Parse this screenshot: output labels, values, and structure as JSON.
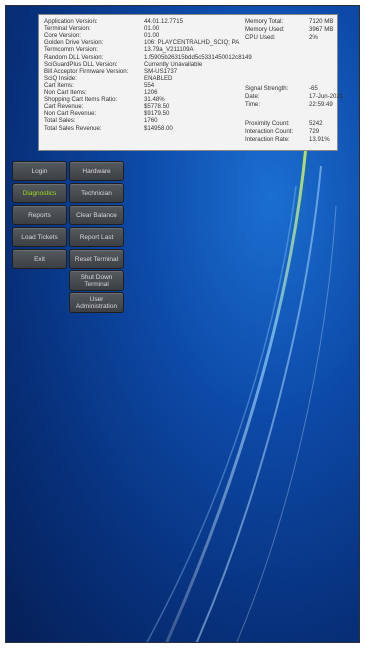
{
  "info_left": [
    {
      "label": "Application Version:",
      "value": "44.01.12.7715"
    },
    {
      "label": "Terminal Version:",
      "value": "01.00"
    },
    {
      "label": "Core Version:",
      "value": "01.00"
    },
    {
      "label": "Golden Drive Version:",
      "value": "106: PLAYCENTRALHD_SCIQ; PA"
    },
    {
      "label": "Termcomm Version:",
      "value": "13.79a_V211109A"
    },
    {
      "label": "Random DLL Version:",
      "value": "1.f5905b26315bdd5c5331450012c8149"
    },
    {
      "label": "SciGuardPlus DLL Version:",
      "value": "Currently Unavailable"
    },
    {
      "label": "Bill Acceptor Firmware Version:",
      "value": "SM-US1737"
    },
    {
      "label": "SciQ Inside:",
      "value": "ENABLED"
    },
    {
      "label": "Cart Items:",
      "value": "554"
    },
    {
      "label": "Non Cart Items:",
      "value": "1206"
    },
    {
      "label": "Shopping Cart Items Ratio:",
      "value": "31.48%"
    },
    {
      "label": "Cart Revenue:",
      "value": "$5778.50"
    },
    {
      "label": "Non Cart Revenue:",
      "value": "$9179.50"
    },
    {
      "label": "Total Sales:",
      "value": "1760"
    },
    {
      "label": "Total Sales Revenue:",
      "value": "$14958.00"
    }
  ],
  "info_right_top": [
    {
      "label": "Memory Total:",
      "value": "7120 MB"
    },
    {
      "label": "Memory Used:",
      "value": "3967 MB"
    },
    {
      "label": "CPU Used:",
      "value": "2%"
    }
  ],
  "info_right_mid": [
    {
      "label": "Signal Strength:",
      "value": "-65"
    },
    {
      "label": "Date:",
      "value": "17-Jun-2021"
    },
    {
      "label": "Time:",
      "value": "22:59:49"
    }
  ],
  "info_right_bot": [
    {
      "label": "Proximity Count:",
      "value": "5242"
    },
    {
      "label": "Interaction Count:",
      "value": "729"
    },
    {
      "label": "Interaction Rate:",
      "value": "13.91%"
    }
  ],
  "buttons": {
    "login": "Login",
    "hardware": "Hardware",
    "diagnostics": "Diagnostics",
    "technician": "Technician",
    "reports": "Reports",
    "clear_balance": "Clear Balance",
    "load_tickets": "Load Tickets",
    "report_last": "Report Last",
    "exit": "Exit",
    "reset_terminal": "Reset Terminal",
    "shut_down_terminal": "Shut Down Terminal",
    "user_administration": "User Administration"
  },
  "colors": {
    "active_button_text": "#9bd61f",
    "background": "#0d4aa8"
  }
}
